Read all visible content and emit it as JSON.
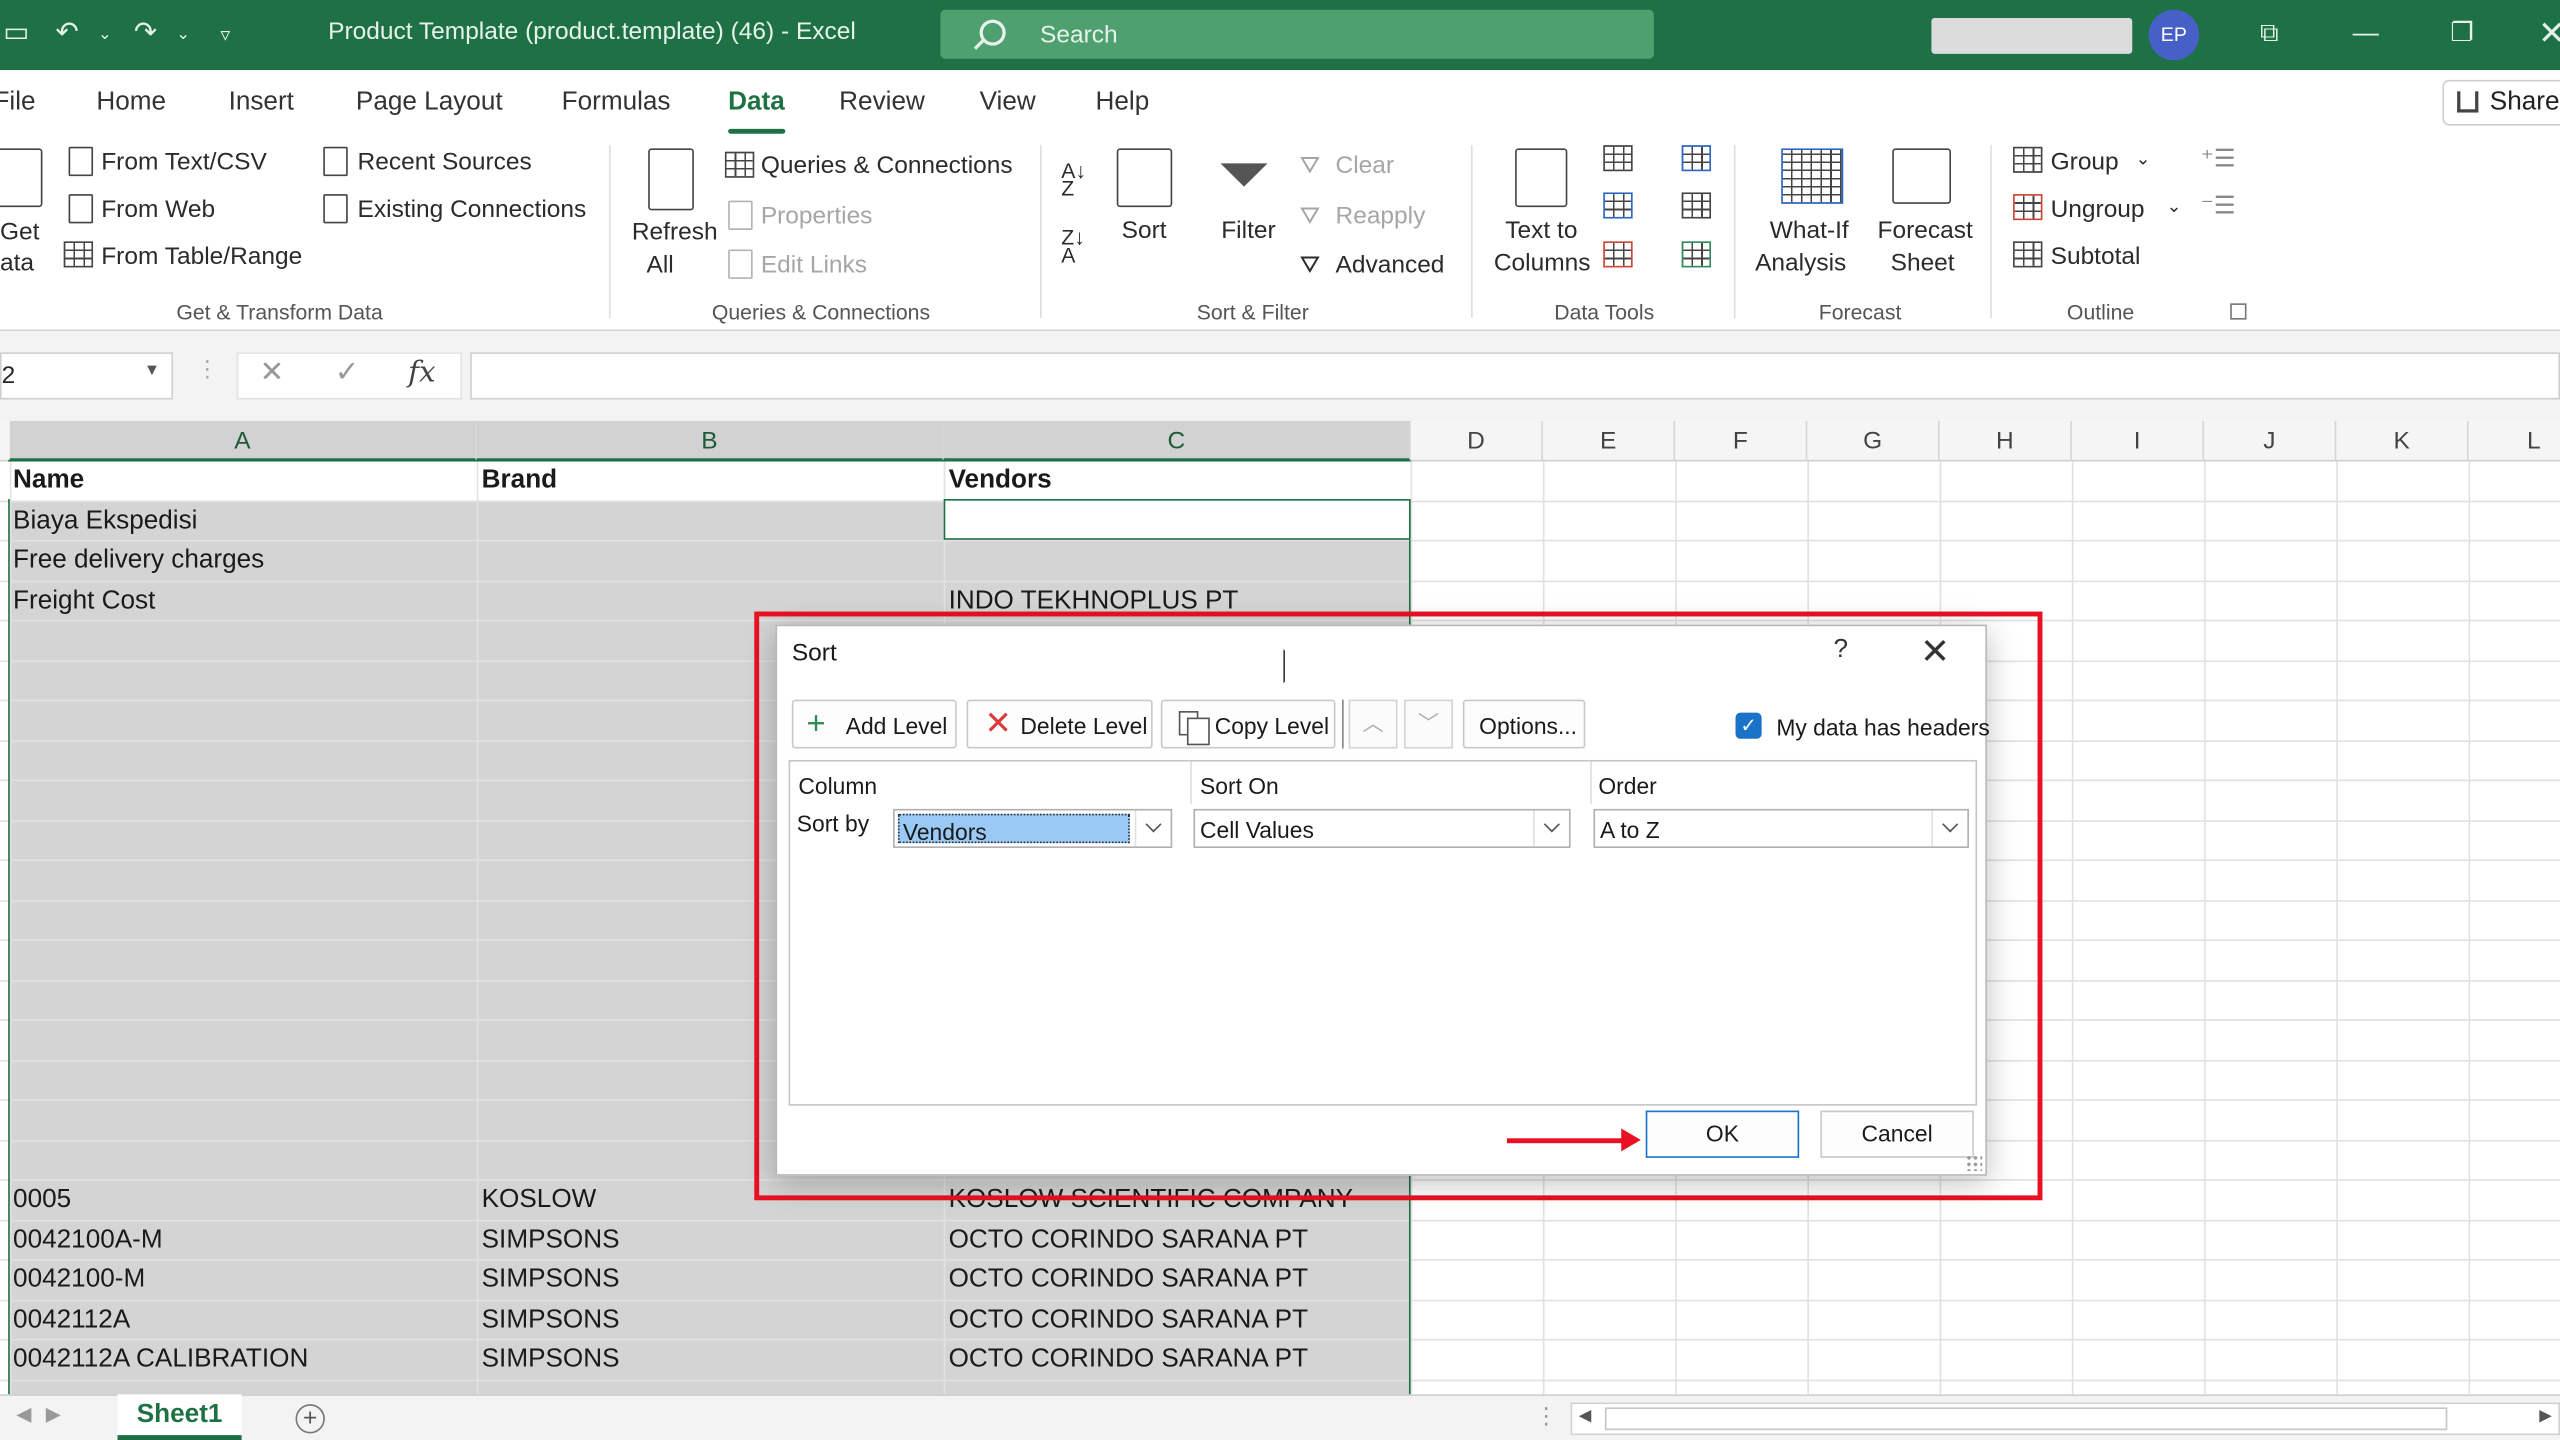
{
  "titlebar": {
    "title": "Product Template (product.template) (46)  -  Excel",
    "search_placeholder": "Search",
    "avatar_initials": "EP"
  },
  "tabs": [
    {
      "label": "File",
      "active": false
    },
    {
      "label": "Home",
      "active": false
    },
    {
      "label": "Insert",
      "active": false
    },
    {
      "label": "Page Layout",
      "active": false
    },
    {
      "label": "Formulas",
      "active": false
    },
    {
      "label": "Data",
      "active": true
    },
    {
      "label": "Review",
      "active": false
    },
    {
      "label": "View",
      "active": false
    },
    {
      "label": "Help",
      "active": false
    }
  ],
  "share_label": "Share",
  "ribbon": {
    "get_data_line1": "Get",
    "get_data_line2": "ata",
    "from_text_csv": "From Text/CSV",
    "from_web": "From Web",
    "from_table_range": "From Table/Range",
    "recent_sources": "Recent Sources",
    "existing_connections": "Existing Connections",
    "group_get_transform": "Get & Transform Data",
    "refresh_line1": "Refresh",
    "refresh_line2": "All",
    "queries_connections": "Queries & Connections",
    "properties": "Properties",
    "edit_links": "Edit Links",
    "group_queries": "Queries & Connections",
    "sort": "Sort",
    "filter": "Filter",
    "clear": "Clear",
    "reapply": "Reapply",
    "advanced": "Advanced",
    "group_sort_filter": "Sort & Filter",
    "text_to_columns_line1": "Text to",
    "text_to_columns_line2": "Columns",
    "group_data_tools": "Data Tools",
    "what_if_line1": "What-If",
    "what_if_line2": "Analysis",
    "forecast_sheet_line1": "Forecast",
    "forecast_sheet_line2": "Sheet",
    "group_forecast": "Forecast",
    "group": "Group",
    "ungroup": "Ungroup",
    "subtotal": "Subtotal",
    "group_outline": "Outline"
  },
  "formula_bar": {
    "name_box": "2"
  },
  "columns": [
    "A",
    "B",
    "C",
    "D",
    "E",
    "F",
    "G",
    "H",
    "I",
    "J",
    "K",
    "L"
  ],
  "header_row": {
    "a": "Name",
    "b": "Brand",
    "c": "Vendors"
  },
  "rows_top": [
    {
      "a": "Biaya Ekspedisi",
      "b": "",
      "c": ""
    },
    {
      "a": "Free delivery charges",
      "b": "",
      "c": ""
    },
    {
      "a": "Freight Cost",
      "b": "",
      "c": "INDO TEKHNOPLUS PT"
    }
  ],
  "rows_bottom": [
    {
      "a": "0005",
      "b": "KOSLOW",
      "c": "KOSLOW SCIENTIFIC COMPANY"
    },
    {
      "a": "0042100A-M",
      "b": "SIMPSONS",
      "c": "OCTO CORINDO SARANA PT"
    },
    {
      "a": "0042100-M",
      "b": "SIMPSONS",
      "c": "OCTO CORINDO SARANA PT"
    },
    {
      "a": "0042112A",
      "b": "SIMPSONS",
      "c": "OCTO CORINDO SARANA PT"
    },
    {
      "a": "0042112A CALIBRATION",
      "b": "SIMPSONS",
      "c": "OCTO CORINDO SARANA PT"
    }
  ],
  "sheet_tab": "Sheet1",
  "dialog": {
    "title": "Sort",
    "help": "?",
    "add_level": "Add Level",
    "delete_level": "Delete Level",
    "copy_level": "Copy Level",
    "options": "Options...",
    "my_data_has_headers": "My data has headers",
    "headers_checked": true,
    "col_column": "Column",
    "col_sort_on": "Sort On",
    "col_order": "Order",
    "sort_by_label": "Sort by",
    "sort_by_value": "Vendors",
    "sort_on_value": "Cell Values",
    "order_value": "A to Z",
    "ok": "OK",
    "cancel": "Cancel"
  },
  "colors": {
    "excel_green": "#1e7145",
    "highlight_red": "#e81123",
    "accent_blue": "#1a73c8"
  }
}
